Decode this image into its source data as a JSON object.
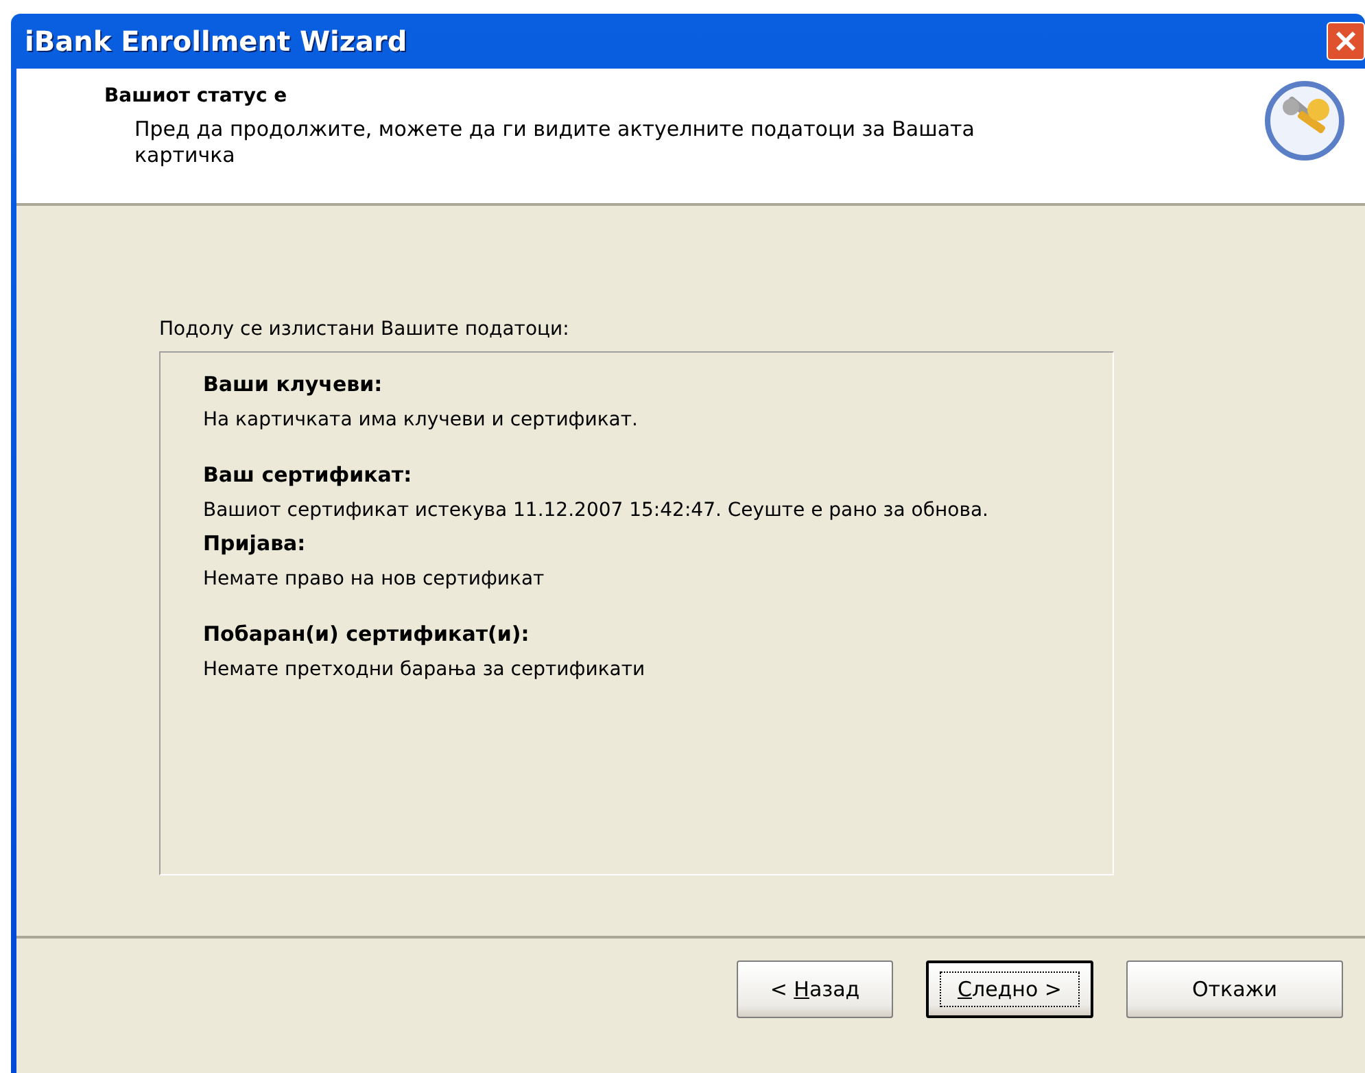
{
  "window": {
    "title": "iBank Enrollment Wizard"
  },
  "header": {
    "title": "Вашиот статус е",
    "subtitle": "Пред да продолжите, можете да ги видите актуелните податоци за Вашата картичка"
  },
  "intro": "Подолу се излистани Вашите податоци:",
  "sections": [
    {
      "heading": "Ваши клучеви:",
      "text": "На картичката има клучеви и сертификат."
    },
    {
      "heading": "Ваш сертификат:",
      "text": "Вашиот сертификат истекува 11.12.2007 15:42:47. Сеуште е рано за обнова."
    },
    {
      "heading": "Пријава:",
      "text": "Немате право на нов сертификат"
    },
    {
      "heading": "Побаран(и) сертификат(и):",
      "text": "Немате претходни барања за сертификати"
    }
  ],
  "buttons": [
    {
      "before": "< ",
      "key": "Н",
      "after": "азад",
      "default": false
    },
    {
      "key": "С",
      "after": "ледно >",
      "default": true
    },
    {
      "before": "Откажи",
      "default": false
    }
  ]
}
